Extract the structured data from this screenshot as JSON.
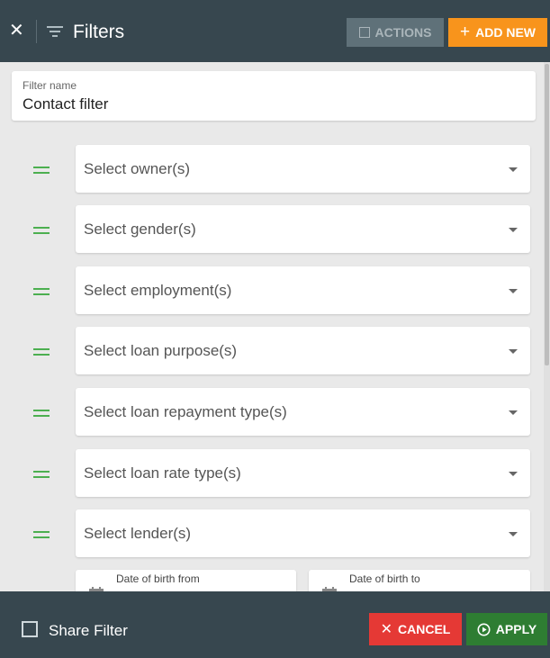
{
  "header": {
    "title": "Filters",
    "close_glyph": "✕",
    "actions_label": "ACTIONS",
    "add_new_label": "ADD NEW",
    "add_new_glyph": "+"
  },
  "filter_name": {
    "label": "Filter name",
    "value": "Contact filter"
  },
  "selects": [
    {
      "placeholder": "Select owner(s)"
    },
    {
      "placeholder": "Select gender(s)"
    },
    {
      "placeholder": "Select employment(s)"
    },
    {
      "placeholder": "Select loan purpose(s)"
    },
    {
      "placeholder": "Select loan repayment type(s)"
    },
    {
      "placeholder": "Select loan rate type(s)"
    },
    {
      "placeholder": "Select lender(s)"
    }
  ],
  "dates": {
    "from_label": "Date of birth from",
    "to_label": "Date of birth to"
  },
  "footer": {
    "share_label": "Share Filter",
    "cancel_label": "CANCEL",
    "cancel_glyph": "✕",
    "apply_label": "APPLY"
  },
  "colors": {
    "header_bg": "#37474f",
    "accent_orange": "#f8941c",
    "cancel_red": "#e53935",
    "apply_green": "#2e7d32",
    "drag_green": "#4caf50"
  },
  "icons": [
    "close-icon",
    "filter-icon",
    "checkbox-icon",
    "plus-icon",
    "drag-handle-icon",
    "caret-down-icon",
    "calendar-icon",
    "play-circle-icon"
  ]
}
